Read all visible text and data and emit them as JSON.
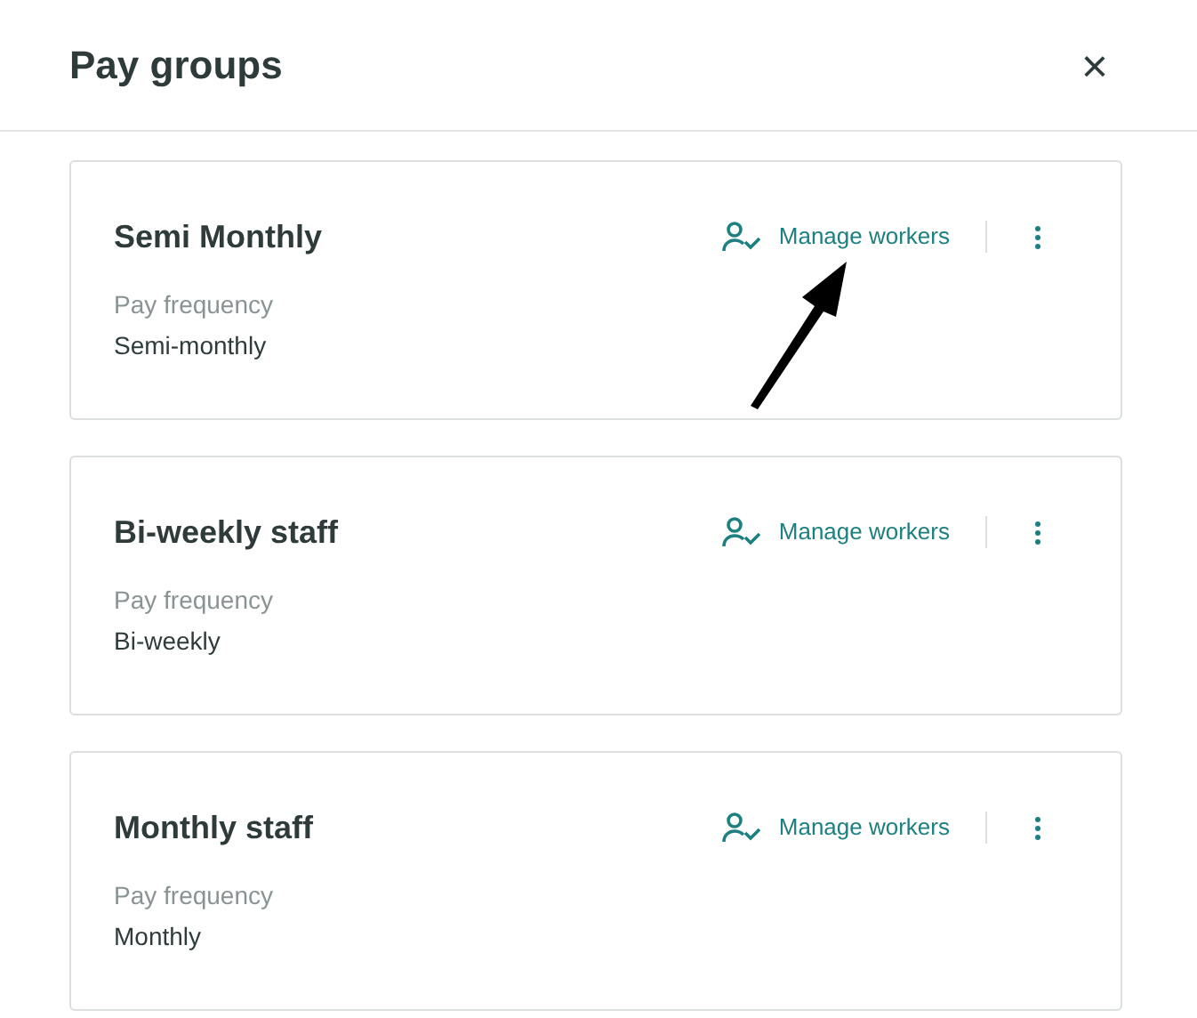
{
  "dialog": {
    "title": "Pay groups",
    "close": "×"
  },
  "pay_groups": [
    {
      "name": "Semi Monthly",
      "action": "Manage workers",
      "field_label": "Pay frequency",
      "field_value": "Semi-monthly"
    },
    {
      "name": "Bi-weekly staff",
      "action": "Manage workers",
      "field_label": "Pay frequency",
      "field_value": "Bi-weekly"
    },
    {
      "name": "Monthly staff",
      "action": "Manage workers",
      "field_label": "Pay frequency",
      "field_value": "Monthly"
    }
  ]
}
